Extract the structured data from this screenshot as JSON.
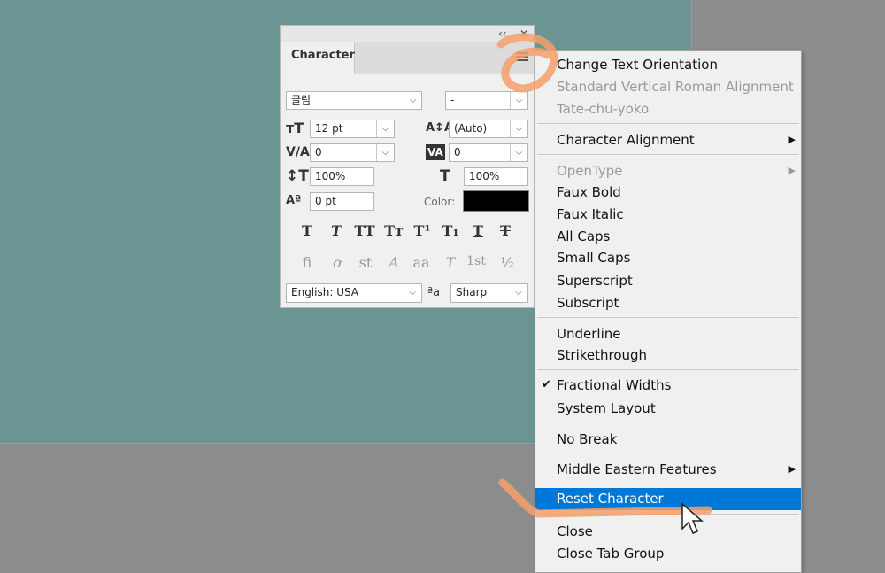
{
  "panel": {
    "tab_label": "Character",
    "collapse_glyph": "‹‹",
    "close_glyph": "✕",
    "font_family": "굴림",
    "font_style": "-",
    "font_size": "12 pt",
    "leading": "(Auto)",
    "kerning": "0",
    "tracking": "0",
    "vertical_scale": "100%",
    "horizontal_scale": "100%",
    "baseline_shift": "0 pt",
    "color_label": "Color:",
    "language": "English: USA",
    "antialias": "Sharp",
    "antialias_icon_text": "ªa",
    "style_buttons": [
      "T",
      "T",
      "TT",
      "Tт",
      "T¹",
      "T₁",
      "T",
      "T"
    ],
    "opentype_buttons": [
      "ﬁ",
      "ơ",
      "st",
      "A",
      "aa",
      "T",
      "1st",
      "½"
    ]
  },
  "menu": {
    "items": [
      {
        "label": "Change Text Orientation",
        "state": "enabled"
      },
      {
        "label": "Standard Vertical Roman Alignment",
        "state": "disabled"
      },
      {
        "label": "Tate-chu-yoko",
        "state": "disabled"
      },
      {
        "label": "Character Alignment",
        "state": "enabled",
        "submenu": true
      },
      {
        "label": "OpenType",
        "state": "disabled",
        "submenu": true
      },
      {
        "label": "Faux Bold",
        "state": "enabled"
      },
      {
        "label": "Faux Italic",
        "state": "enabled"
      },
      {
        "label": "All Caps",
        "state": "enabled"
      },
      {
        "label": "Small Caps",
        "state": "enabled"
      },
      {
        "label": "Superscript",
        "state": "enabled"
      },
      {
        "label": "Subscript",
        "state": "enabled"
      },
      {
        "label": "Underline",
        "state": "enabled"
      },
      {
        "label": "Strikethrough",
        "state": "enabled"
      },
      {
        "label": "Fractional Widths",
        "state": "checked"
      },
      {
        "label": "System Layout",
        "state": "enabled"
      },
      {
        "label": "No Break",
        "state": "enabled"
      },
      {
        "label": "Middle Eastern Features",
        "state": "enabled",
        "submenu": true
      },
      {
        "label": "Reset Character",
        "state": "highlighted"
      },
      {
        "label": "Close",
        "state": "enabled"
      },
      {
        "label": "Close Tab Group",
        "state": "enabled"
      }
    ]
  },
  "colors": {
    "canvas": "#6a9593",
    "workspace": "#8c8c8c",
    "highlight": "#0078d7",
    "annotation": "#f4a06a",
    "text_color_swatch": "#000000"
  }
}
